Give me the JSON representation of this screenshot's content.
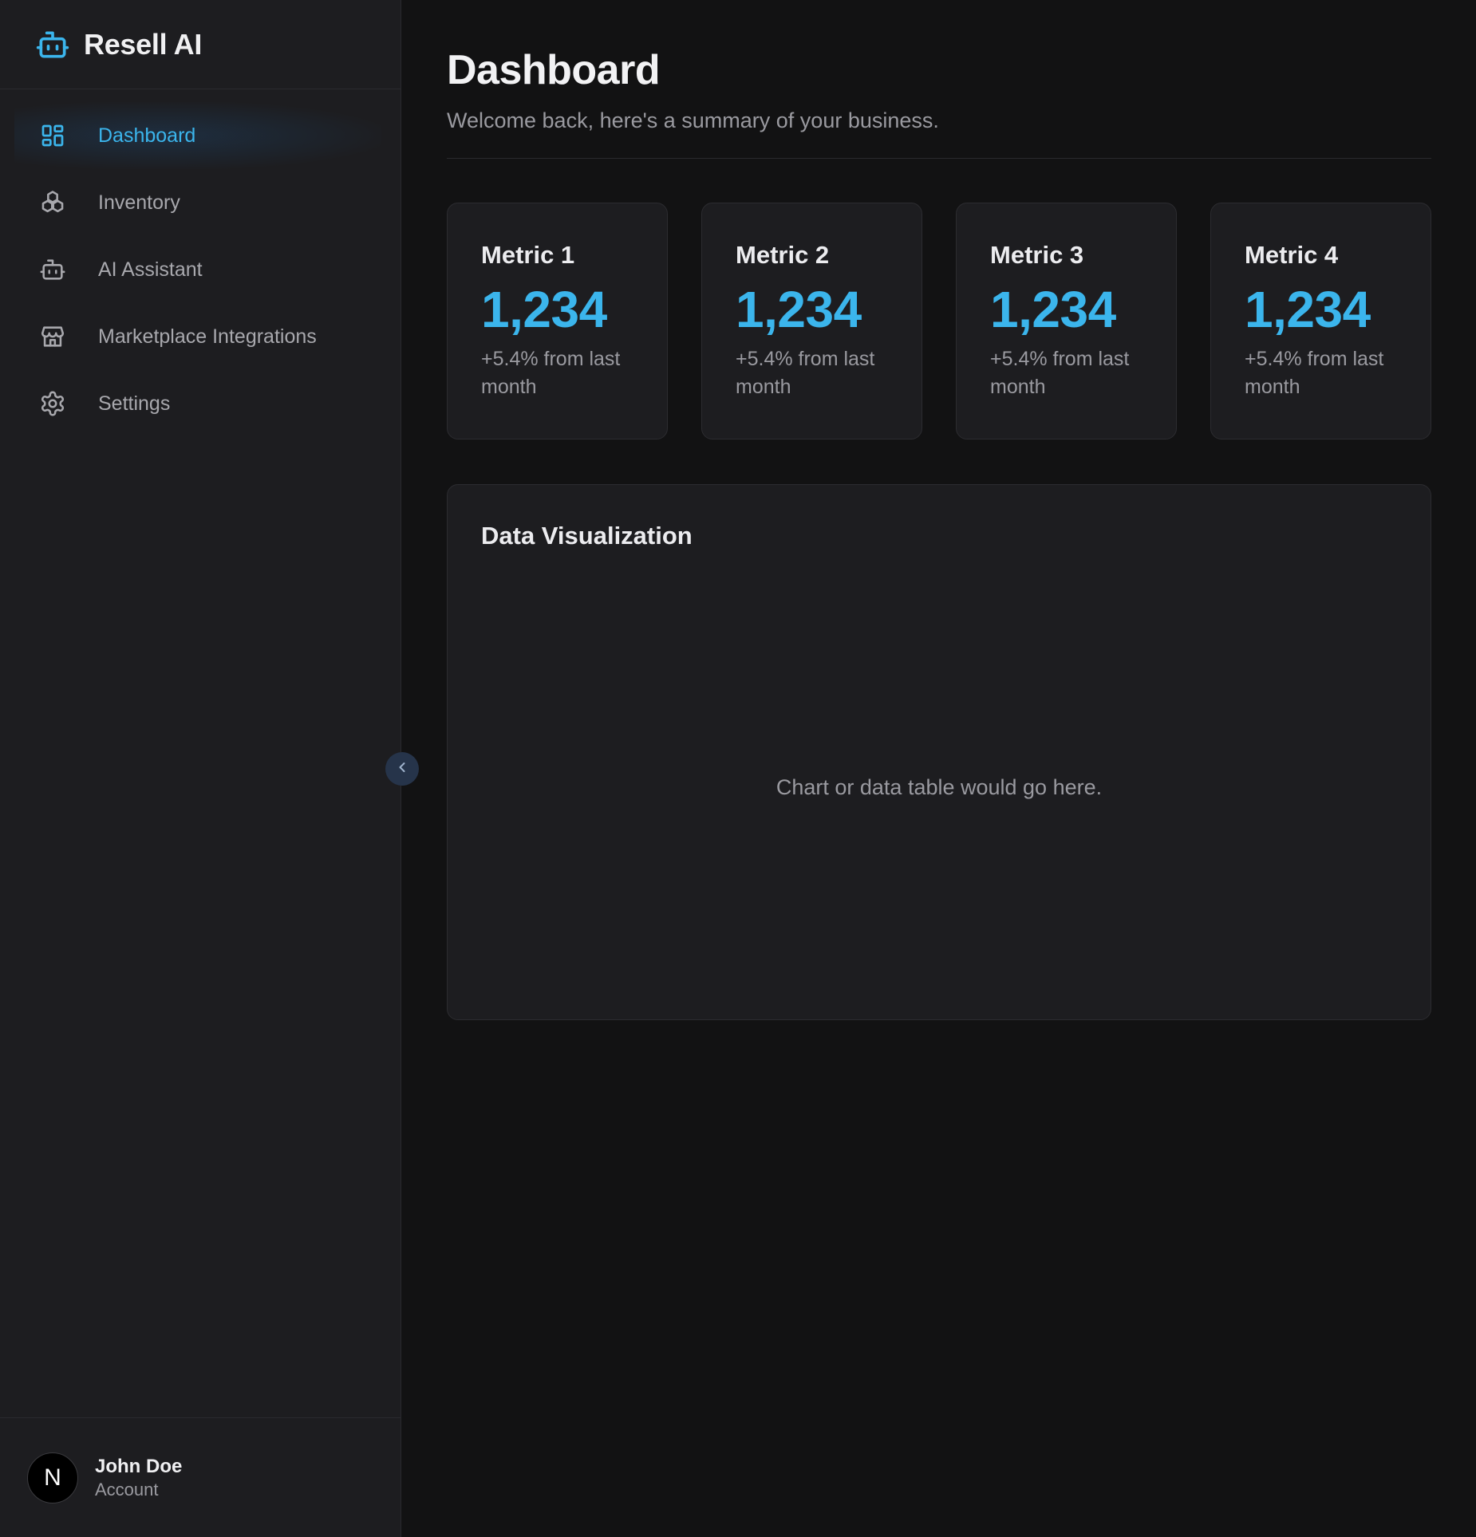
{
  "brand": {
    "name": "Resell AI",
    "icon": "robot-icon",
    "accent": "#3bb5ec"
  },
  "sidebar": {
    "items": [
      {
        "label": "Dashboard",
        "icon": "dashboard-grid-icon",
        "active": true
      },
      {
        "label": "Inventory",
        "icon": "boxes-icon",
        "active": false
      },
      {
        "label": "AI Assistant",
        "icon": "robot-icon",
        "active": false
      },
      {
        "label": "Marketplace Integrations",
        "icon": "store-icon",
        "active": false
      },
      {
        "label": "Settings",
        "icon": "gear-icon",
        "active": false
      }
    ],
    "collapse_icon": "chevron-left-icon",
    "account": {
      "avatar_letter": "N",
      "name": "John Doe",
      "subtitle": "Account"
    }
  },
  "header": {
    "title": "Dashboard",
    "subtitle": "Welcome back, here's a summary of your business."
  },
  "metrics": [
    {
      "title": "Metric 1",
      "value": "1,234",
      "change": "+5.4% from last month"
    },
    {
      "title": "Metric 2",
      "value": "1,234",
      "change": "+5.4% from last month"
    },
    {
      "title": "Metric 3",
      "value": "1,234",
      "change": "+5.4% from last month"
    },
    {
      "title": "Metric 4",
      "value": "1,234",
      "change": "+5.4% from last month"
    }
  ],
  "visualization": {
    "title": "Data Visualization",
    "placeholder": "Chart or data table would go here."
  }
}
